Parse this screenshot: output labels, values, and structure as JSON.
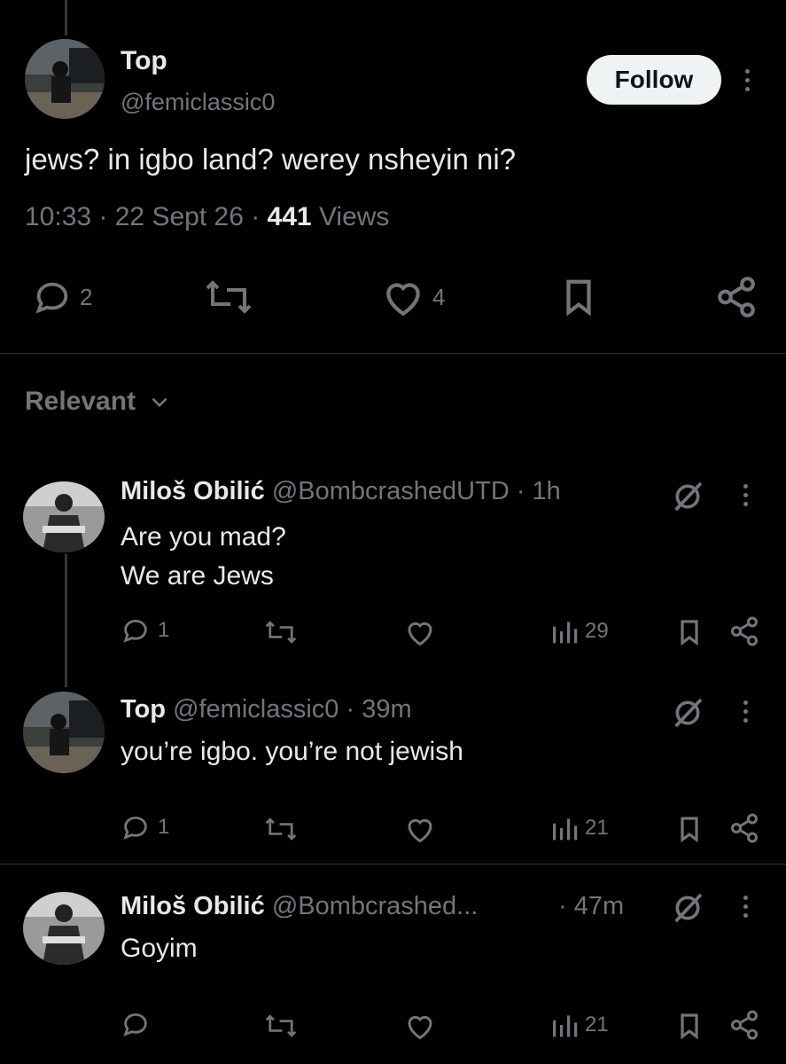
{
  "main_post": {
    "name": "Top",
    "handle": "@femiclassic0",
    "follow_label": "Follow",
    "text": "jews? in igbo land? werey nsheyin ni?",
    "time": "10:33",
    "date": "22 Sept 26",
    "views_count": "441",
    "views_label": "Views",
    "replies": "2",
    "likes": "4"
  },
  "sort": {
    "label": "Relevant"
  },
  "replies": [
    {
      "name": "Miloš Obilić",
      "handle": "@BombcrashedUTD",
      "time": "· 1h",
      "lines": [
        "Are you mad?",
        "We are Jews"
      ],
      "reply_count": "1",
      "views": "29"
    },
    {
      "name": "Top",
      "handle": "@femiclassic0",
      "time": "· 39m",
      "lines": [
        "you’re igbo. you’re not jewish"
      ],
      "reply_count": "1",
      "views": "21"
    },
    {
      "name": "Miloš Obilić",
      "handle": "@Bombcrashed...",
      "time": "· 47m",
      "lines": [
        "Goyim"
      ],
      "reply_count": "",
      "views": "21"
    }
  ],
  "colors": {
    "background": "#000000",
    "text": "#e7e9ea",
    "muted": "#71767b",
    "divider": "#2f3336"
  }
}
